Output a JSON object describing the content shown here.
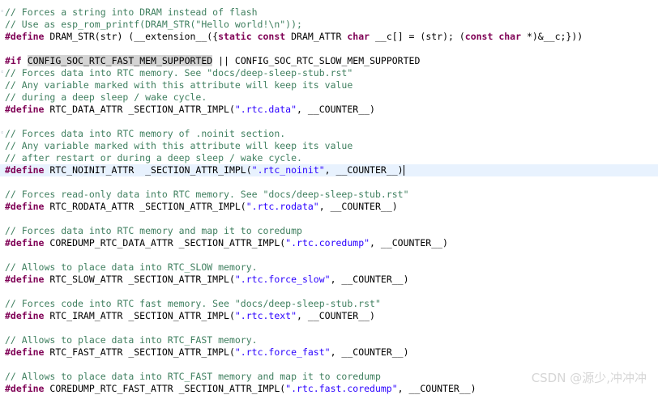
{
  "colors": {
    "background": "#ffffff",
    "comment": "#3f7f5f",
    "keyword": "#7f0055",
    "string": "#2a00ff",
    "identifier": "#000000",
    "current_line": "#e8f2fe",
    "highlight": "#d4d4d4",
    "watermark": "#d6d6d6"
  },
  "lines": [
    {
      "fold": true,
      "tokens": [
        {
          "t": "c",
          "v": "// Forces a string into DRAM instead of flash"
        }
      ]
    },
    {
      "tokens": [
        {
          "t": "c",
          "v": "// Use as esp_rom_printf(DRAM_STR(\"Hello world!\\n\"));"
        }
      ]
    },
    {
      "tokens": [
        {
          "t": "k",
          "v": "#define"
        },
        {
          "t": "i",
          "v": " DRAM_STR(str) (__extension__({"
        },
        {
          "t": "k",
          "v": "static const"
        },
        {
          "t": "i",
          "v": " DRAM_ATTR "
        },
        {
          "t": "k",
          "v": "char"
        },
        {
          "t": "i",
          "v": " __c[] = (str); ("
        },
        {
          "t": "k",
          "v": "const char"
        },
        {
          "t": "i",
          "v": " *)&__c;}))"
        }
      ]
    },
    {
      "tokens": []
    },
    {
      "tokens": [
        {
          "t": "k",
          "v": "#if"
        },
        {
          "t": "i",
          "v": " "
        },
        {
          "t": "h",
          "v": "CONFIG_SOC_RTC_FAST_MEM_SUPPORTED"
        },
        {
          "t": "i",
          "v": " || CONFIG_SOC_RTC_SLOW_MEM_SUPPORTED"
        }
      ]
    },
    {
      "fold": true,
      "tokens": [
        {
          "t": "c",
          "v": "// Forces data into RTC memory. See \"docs/deep-sleep-stub.rst\""
        }
      ]
    },
    {
      "tokens": [
        {
          "t": "c",
          "v": "// Any variable marked with this attribute will keep its value"
        }
      ]
    },
    {
      "tokens": [
        {
          "t": "c",
          "v": "// during a deep sleep / wake cycle."
        }
      ]
    },
    {
      "tokens": [
        {
          "t": "k",
          "v": "#define"
        },
        {
          "t": "i",
          "v": " RTC_DATA_ATTR _SECTION_ATTR_IMPL("
        },
        {
          "t": "s",
          "v": "\".rtc.data\""
        },
        {
          "t": "i",
          "v": ", __COUNTER__)"
        }
      ]
    },
    {
      "tokens": []
    },
    {
      "fold": true,
      "tokens": [
        {
          "t": "c",
          "v": "// Forces data into RTC memory of .noinit section."
        }
      ]
    },
    {
      "tokens": [
        {
          "t": "c",
          "v": "// Any variable marked with this attribute will keep its value"
        }
      ]
    },
    {
      "tokens": [
        {
          "t": "c",
          "v": "// after restart or during a deep sleep / wake cycle."
        }
      ]
    },
    {
      "current": true,
      "tokens": [
        {
          "t": "k",
          "v": "#define"
        },
        {
          "t": "i",
          "v": " RTC_NOINIT_ATTR  _SECTION_ATTR_IMPL("
        },
        {
          "t": "s",
          "v": "\".rtc_noinit\""
        },
        {
          "t": "i",
          "v": ", __COUNTER__)"
        },
        {
          "t": "caret",
          "v": ""
        }
      ]
    },
    {
      "tokens": []
    },
    {
      "tokens": [
        {
          "t": "c",
          "v": "// Forces read-only data into RTC memory. See \"docs/deep-sleep-stub.rst\""
        }
      ]
    },
    {
      "tokens": [
        {
          "t": "k",
          "v": "#define"
        },
        {
          "t": "i",
          "v": " RTC_RODATA_ATTR _SECTION_ATTR_IMPL("
        },
        {
          "t": "s",
          "v": "\".rtc.rodata\""
        },
        {
          "t": "i",
          "v": ", __COUNTER__)"
        }
      ]
    },
    {
      "tokens": []
    },
    {
      "tokens": [
        {
          "t": "c",
          "v": "// Forces data into RTC memory and map it to coredump"
        }
      ]
    },
    {
      "tokens": [
        {
          "t": "k",
          "v": "#define"
        },
        {
          "t": "i",
          "v": " COREDUMP_RTC_DATA_ATTR _SECTION_ATTR_IMPL("
        },
        {
          "t": "s",
          "v": "\".rtc.coredump\""
        },
        {
          "t": "i",
          "v": ", __COUNTER__)"
        }
      ]
    },
    {
      "tokens": []
    },
    {
      "tokens": [
        {
          "t": "c",
          "v": "// Allows to place data into RTC_SLOW memory."
        }
      ]
    },
    {
      "tokens": [
        {
          "t": "k",
          "v": "#define"
        },
        {
          "t": "i",
          "v": " RTC_SLOW_ATTR _SECTION_ATTR_IMPL("
        },
        {
          "t": "s",
          "v": "\".rtc.force_slow\""
        },
        {
          "t": "i",
          "v": ", __COUNTER__)"
        }
      ]
    },
    {
      "tokens": []
    },
    {
      "tokens": [
        {
          "t": "c",
          "v": "// Forces code into RTC fast memory. See \"docs/deep-sleep-stub.rst\""
        }
      ]
    },
    {
      "tokens": [
        {
          "t": "k",
          "v": "#define"
        },
        {
          "t": "i",
          "v": " RTC_IRAM_ATTR _SECTION_ATTR_IMPL("
        },
        {
          "t": "s",
          "v": "\".rtc.text\""
        },
        {
          "t": "i",
          "v": ", __COUNTER__)"
        }
      ]
    },
    {
      "tokens": []
    },
    {
      "tokens": [
        {
          "t": "c",
          "v": "// Allows to place data into RTC_FAST memory."
        }
      ]
    },
    {
      "tokens": [
        {
          "t": "k",
          "v": "#define"
        },
        {
          "t": "i",
          "v": " RTC_FAST_ATTR _SECTION_ATTR_IMPL("
        },
        {
          "t": "s",
          "v": "\".rtc.force_fast\""
        },
        {
          "t": "i",
          "v": ", __COUNTER__)"
        }
      ]
    },
    {
      "tokens": []
    },
    {
      "tokens": [
        {
          "t": "c",
          "v": "// Allows to place data into RTC_FAST memory and map it to coredump"
        }
      ]
    },
    {
      "tokens": [
        {
          "t": "k",
          "v": "#define"
        },
        {
          "t": "i",
          "v": " COREDUMP_RTC_FAST_ATTR _SECTION_ATTR_IMPL("
        },
        {
          "t": "s",
          "v": "\".rtc.fast.coredump\""
        },
        {
          "t": "i",
          "v": ", __COUNTER__)"
        }
      ]
    }
  ],
  "watermark": "CSDN @源少,冲冲冲"
}
